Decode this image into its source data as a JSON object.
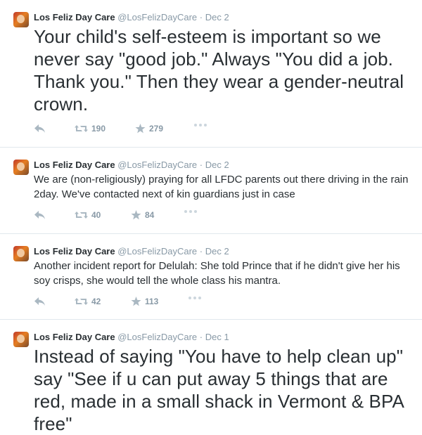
{
  "tweets": [
    {
      "name": "Los Feliz Day Care",
      "handle": "@LosFelizDayCare",
      "separator": "·",
      "date": "Dec 2",
      "text": "Your child's self-esteem is important so we never say \"good job.\" Always \"You did a job. Thank you.\" Then they wear a gender-neutral crown.",
      "retweets": "190",
      "favorites": "279"
    },
    {
      "name": "Los Feliz Day Care",
      "handle": "@LosFelizDayCare",
      "separator": "·",
      "date": "Dec 2",
      "text": "We are (non-religiously) praying for all LFDC parents out there driving in the rain 2day. We've contacted next of kin guardians just in case",
      "retweets": "40",
      "favorites": "84"
    },
    {
      "name": "Los Feliz Day Care",
      "handle": "@LosFelizDayCare",
      "separator": "·",
      "date": "Dec 2",
      "text": "Another incident report for Delulah: She told Prince that if he didn't give her his soy crisps, she would tell the whole class his mantra.",
      "retweets": "42",
      "favorites": "113"
    },
    {
      "name": "Los Feliz Day Care",
      "handle": "@LosFelizDayCare",
      "separator": "·",
      "date": "Dec 1",
      "text": "Instead of saying \"You have to help clean up\" say \"See if u can put away 5 things that are red, made in a small shack in Vermont & BPA free\""
    }
  ],
  "icons": {
    "reply": "reply-icon",
    "retweet": "retweet-icon",
    "favorite": "star-icon",
    "more": "more-icon"
  },
  "colors": {
    "text": "#292f33",
    "muted": "#8899a6",
    "icon": "#aab8c2",
    "divider": "#e1e8ed"
  }
}
